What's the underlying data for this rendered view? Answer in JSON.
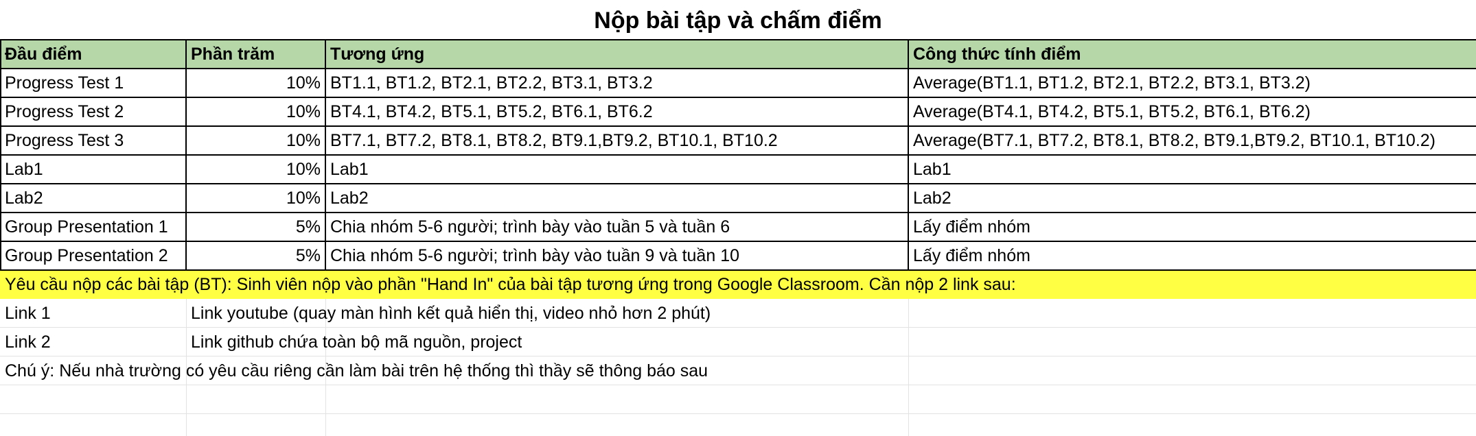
{
  "title": "Nộp bài tập và chấm điểm",
  "header": {
    "col1": "Đầu điểm",
    "col2": "Phần trăm",
    "col3": "Tương ứng",
    "col4": "Công thức tính điểm"
  },
  "rows": [
    {
      "name": "Progress Test 1",
      "percent": "10%",
      "items": "BT1.1, BT1.2, BT2.1, BT2.2, BT3.1, BT3.2",
      "formula": "Average(BT1.1, BT1.2, BT2.1, BT2.2, BT3.1, BT3.2)"
    },
    {
      "name": "Progress Test 2",
      "percent": "10%",
      "items": "BT4.1, BT4.2, BT5.1, BT5.2, BT6.1, BT6.2",
      "formula": "Average(BT4.1, BT4.2, BT5.1, BT5.2, BT6.1, BT6.2)"
    },
    {
      "name": "Progress Test 3",
      "percent": "10%",
      "items": "BT7.1, BT7.2, BT8.1, BT8.2, BT9.1,BT9.2, BT10.1, BT10.2",
      "formula": "Average(BT7.1, BT7.2, BT8.1, BT8.2, BT9.1,BT9.2, BT10.1, BT10.2)"
    },
    {
      "name": "Lab1",
      "percent": "10%",
      "items": "Lab1",
      "formula": "Lab1"
    },
    {
      "name": "Lab2",
      "percent": "10%",
      "items": "Lab2",
      "formula": "Lab2"
    },
    {
      "name": "Group Presentation 1",
      "percent": "5%",
      "items": "Chia nhóm 5-6 người; trình bày vào tuần 5 và tuần 6",
      "formula": "Lấy điểm nhóm"
    },
    {
      "name": "Group Presentation 2",
      "percent": "5%",
      "items": "Chia nhóm 5-6 người; trình bày vào tuần 9 và tuần 10",
      "formula": "Lấy điểm nhóm"
    }
  ],
  "notice": "Yêu cầu nộp các bài tập (BT): Sinh viên nộp vào phần \"Hand In\" của bài tập tương ứng trong Google Classroom. Cần nộp 2 link sau:",
  "links": [
    {
      "label": "Link 1",
      "desc": "Link youtube (quay màn hình kết quả hiển thị, video nhỏ hơn 2 phút)"
    },
    {
      "label": "Link 2",
      "desc": "Link github chứa toàn bộ mã nguồn, project"
    }
  ],
  "note": "Chú ý: Nếu nhà trường có yêu cầu riêng cần làm bài trên hệ thống thì thầy sẽ thông báo sau",
  "colors": {
    "header_bg": "#b6d7a8",
    "notice_bg": "#ffff44"
  }
}
